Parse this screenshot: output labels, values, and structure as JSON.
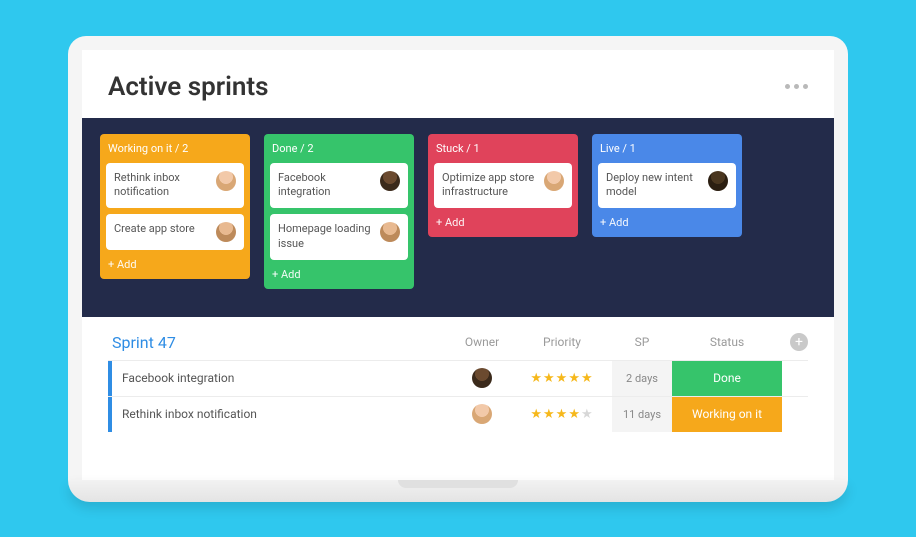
{
  "header": {
    "title": "Active sprints"
  },
  "board": {
    "columns": [
      {
        "key": "working",
        "title": "Working on it / 2",
        "color": "#f6a81b",
        "add_label": "+ Add",
        "cards": [
          {
            "text": "Rethink inbox notification",
            "avatar": "av1"
          },
          {
            "text": "Create app store",
            "avatar": "av3"
          }
        ]
      },
      {
        "key": "done",
        "title": "Done / 2",
        "color": "#36c46b",
        "add_label": "+ Add",
        "cards": [
          {
            "text": "Facebook integration",
            "avatar": "av2"
          },
          {
            "text": "Homepage loading issue",
            "avatar": "av3"
          }
        ]
      },
      {
        "key": "stuck",
        "title": "Stuck / 1",
        "color": "#e0435b",
        "add_label": "+ Add",
        "cards": [
          {
            "text": "Optimize app store infrastructure",
            "avatar": "av1"
          }
        ]
      },
      {
        "key": "live",
        "title": "Live / 1",
        "color": "#4a88e8",
        "add_label": "+ Add",
        "cards": [
          {
            "text": "Deploy new intent model",
            "avatar": "av4"
          }
        ]
      }
    ]
  },
  "list": {
    "sprint_title": "Sprint 47",
    "headers": {
      "owner": "Owner",
      "priority": "Priority",
      "sp": "SP",
      "status": "Status"
    },
    "rows": [
      {
        "title": "Facebook integration",
        "avatar": "av2",
        "priority": 5,
        "sp": "2 days",
        "status_label": "Done",
        "status_key": "done"
      },
      {
        "title": "Rethink inbox notification",
        "avatar": "av1",
        "priority": 4,
        "sp": "11 days",
        "status_label": "Working on it",
        "status_key": "working"
      }
    ]
  }
}
